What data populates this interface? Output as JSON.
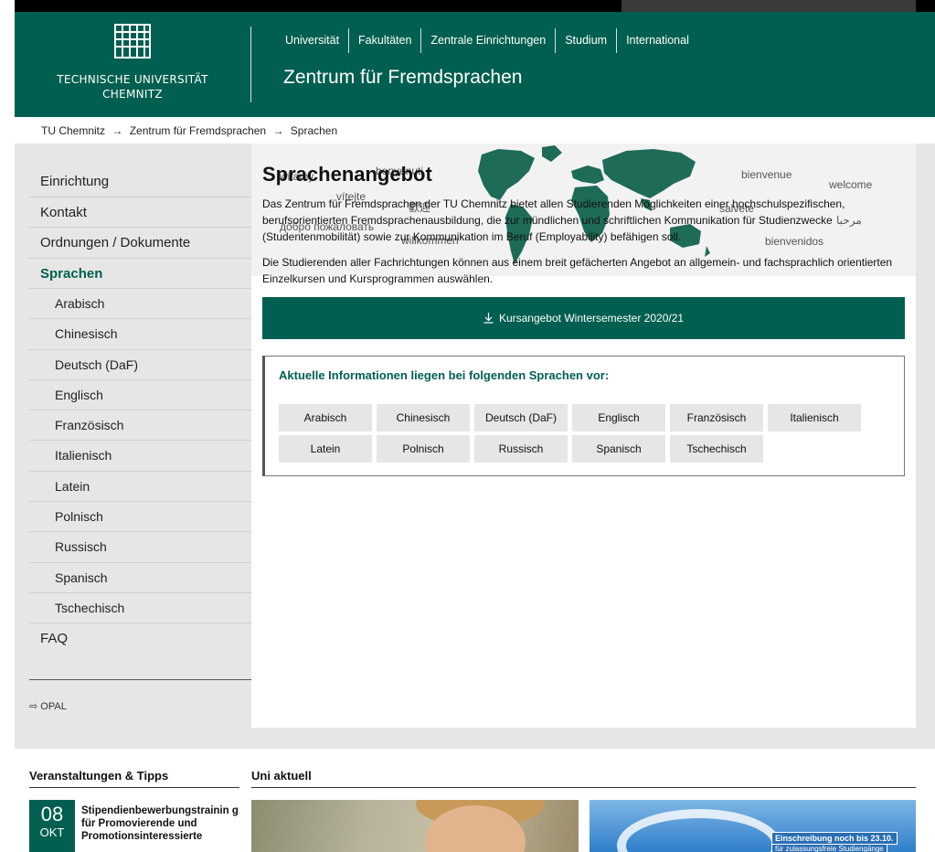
{
  "header": {
    "logo_line1": "TECHNISCHE UNIVERSITÄT",
    "logo_line2": "CHEMNITZ",
    "nav": [
      "Universität",
      "Fakultäten",
      "Zentrale Einrichtungen",
      "Studium",
      "International"
    ],
    "site_title": "Zentrum für Fremdsprachen"
  },
  "breadcrumb": [
    "TU Chemnitz",
    "→",
    "Zentrum für Fremdsprachen",
    "→",
    "Sprachen"
  ],
  "sidebar": {
    "items": [
      "Einrichtung",
      "Kontakt",
      "Ordnungen / Dokumente"
    ],
    "active": "Sprachen",
    "sub_items": [
      "Arabisch",
      "Chinesisch",
      "Deutsch (DaF)",
      "Englisch",
      "Französisch",
      "Italienisch",
      "Latein",
      "Polnisch",
      "Russisch",
      "Spanisch",
      "Tschechisch"
    ],
    "faq": "FAQ",
    "opal": "OPAL",
    "opal_icon": "⇨"
  },
  "banner": {
    "words": [
      "witamy",
      "benvenuti",
      "vítejte",
      "歡迎",
      "добро пожаловать",
      "willkommen",
      "bienvenue",
      "welcome",
      "salvete",
      "مرحبا",
      "bienvenidos"
    ]
  },
  "main": {
    "title": "Sprachenangebot",
    "para1": "Das Zentrum für Fremdsprachen der TU Chemnitz bietet allen Studierenden Möglichkeiten einer hochschulspezifischen, berufsorientierten Fremdsprachenausbildung, die zur mündlichen und schriftlichen Kommunikation für Studienzwecke (Studentenmobilität) sowie zur Kommunikation im Beruf (Employability) befähigen soll.",
    "para2": "Die Studierenden aller Fachrichtungen können aus einem breit gefächerten Angebot an allgemein- und fachsprachlich orientierten Einzelkursen und Kursprogrammen auswählen.",
    "download_label": "Kursangebot Wintersemester 2020/21",
    "info_title": "Aktuelle Informationen liegen bei folgenden Sprachen vor:",
    "languages": [
      "Arabisch",
      "Chinesisch",
      "Deutsch (DaF)",
      "Englisch",
      "Französisch",
      "Italienisch",
      "Latein",
      "Polnisch",
      "Russisch",
      "Spanisch",
      "Tschechisch"
    ]
  },
  "footer": {
    "events_title": "Veranstaltungen & Tipps",
    "news_title": "Uni aktuell",
    "event": {
      "day": "08",
      "month": "OKT",
      "title": "Stipendienbewerbungstrainin g für Promovierende und Promotionsinteressierte"
    },
    "news2_badge": "Einschreibung noch bis 23.10.",
    "news2_sub": "für zulassungsfreie Studiengänge"
  },
  "colors": {
    "brand_green": "#005f50",
    "sidebar_bg": "#e6e6e6"
  }
}
